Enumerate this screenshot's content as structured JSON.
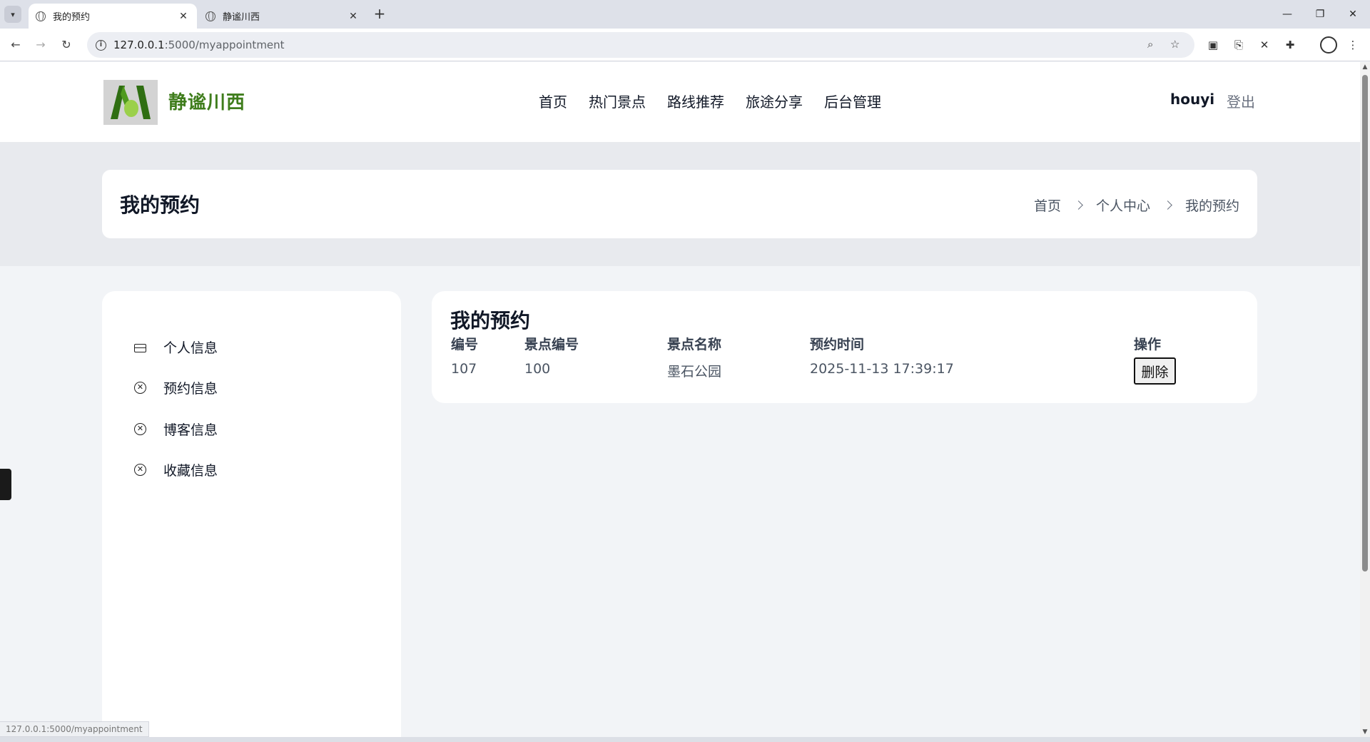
{
  "browser": {
    "tabs": [
      {
        "title": "我的预约",
        "active": true
      },
      {
        "title": "静谧川西",
        "active": false
      }
    ],
    "url_host": "127.0.0.1",
    "url_path": ":5000/myappointment",
    "status_url": "127.0.0.1:5000/myappointment",
    "icons": {
      "tab_menu": "▾",
      "close": "✕",
      "new_tab": "+",
      "minimize": "—",
      "restore": "❐",
      "window_close": "✕",
      "back": "←",
      "forward": "→",
      "reload": "↻",
      "info": "i",
      "zoom": "⌕",
      "star": "☆",
      "ext1": "▣",
      "bookmark": "⎘",
      "ext2": "✕",
      "puzzle": "✚",
      "menu": "⋮"
    }
  },
  "header": {
    "site_name": "静谧川西",
    "nav": [
      "首页",
      "热门景点",
      "路线推荐",
      "旅途分享",
      "后台管理"
    ],
    "username": "houyi",
    "logout": "登出"
  },
  "banner": {
    "title": "我的预约",
    "breadcrumb": [
      "首页",
      "个人中心",
      "我的预约"
    ]
  },
  "sidebar": {
    "items": [
      {
        "label": "个人信息",
        "icon": "id-card-icon"
      },
      {
        "label": "预约信息",
        "icon": "circle-x-icon"
      },
      {
        "label": "博客信息",
        "icon": "circle-x-icon"
      },
      {
        "label": "收藏信息",
        "icon": "circle-x-icon"
      }
    ],
    "x_glyph": "✕"
  },
  "appointments": {
    "title": "我的预约",
    "columns": [
      "编号",
      "景点编号",
      "景点名称",
      "预约时间",
      "操作"
    ],
    "rows": [
      {
        "id": "107",
        "spot_id": "100",
        "spot_name": "墨石公园",
        "time": "2025-11-13 17:39:17",
        "action": "删除"
      }
    ]
  },
  "colors": {
    "brand_green": "#3f7d1c",
    "page_bg": "#f2f4f7"
  }
}
